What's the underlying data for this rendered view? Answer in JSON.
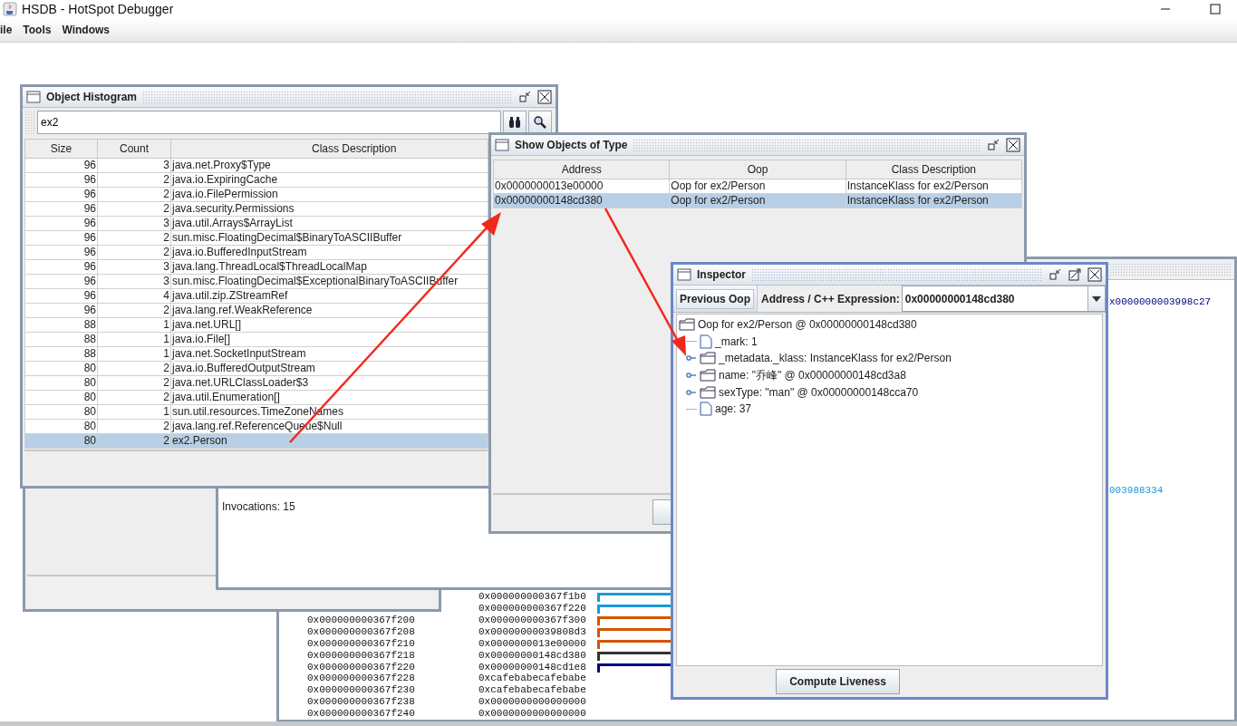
{
  "window": {
    "title": "HSDB - HotSpot Debugger"
  },
  "menu": [
    {
      "label": "ile"
    },
    {
      "label": "Tools"
    },
    {
      "label": "Windows"
    }
  ],
  "memory_viewer": {
    "top_text": "x0000000003998c27",
    "side_text": "003988334",
    "rows": [
      {
        "value": "0x000000000367f1b0",
        "color": "#1a9ad6"
      },
      {
        "value": "0x000000000367f220",
        "color": "#1a9ad6"
      },
      {
        "address": "0x000000000367f200",
        "value": "0x000000000367f300",
        "color": "#d35400"
      },
      {
        "address": "0x000000000367f208",
        "value": "0x00000000039808d3",
        "color": "#d35400"
      },
      {
        "address": "0x000000000367f210",
        "value": "0x0000000013e00000",
        "color": "#d35400"
      },
      {
        "address": "0x000000000367f218",
        "value": "0x00000000148cd380",
        "color": "#333333"
      },
      {
        "address": "0x000000000367f220",
        "value": "0x00000000148cd1e8",
        "color": "#00008b"
      },
      {
        "address": "0x000000000367f228",
        "value": "0xcafebabecafebabe"
      },
      {
        "address": "0x000000000367f230",
        "value": "0xcafebabecafebabe"
      },
      {
        "address": "0x000000000367f238",
        "value": "0x0000000000000000"
      },
      {
        "address": "0x000000000367f240",
        "value": "0x0000000000000000"
      }
    ]
  },
  "output_window": {
    "text": "Invocations: 15"
  },
  "object_histogram": {
    "title": "Object Histogram",
    "filter": "ex2",
    "columns": [
      "Size",
      "Count",
      "Class Description"
    ],
    "rows": [
      {
        "size": "96",
        "count": "3",
        "class": "java.net.Proxy$Type",
        "selected": false
      },
      {
        "size": "96",
        "count": "2",
        "class": "java.io.ExpiringCache",
        "selected": false
      },
      {
        "size": "96",
        "count": "2",
        "class": "java.io.FilePermission",
        "selected": false
      },
      {
        "size": "96",
        "count": "2",
        "class": "java.security.Permissions",
        "selected": false
      },
      {
        "size": "96",
        "count": "3",
        "class": "java.util.Arrays$ArrayList",
        "selected": false
      },
      {
        "size": "96",
        "count": "2",
        "class": "sun.misc.FloatingDecimal$BinaryToASCIIBuffer",
        "selected": false
      },
      {
        "size": "96",
        "count": "2",
        "class": "java.io.BufferedInputStream",
        "selected": false
      },
      {
        "size": "96",
        "count": "3",
        "class": "java.lang.ThreadLocal$ThreadLocalMap",
        "selected": false
      },
      {
        "size": "96",
        "count": "3",
        "class": "sun.misc.FloatingDecimal$ExceptionalBinaryToASCIIBuffer",
        "selected": false
      },
      {
        "size": "96",
        "count": "4",
        "class": "java.util.zip.ZStreamRef",
        "selected": false
      },
      {
        "size": "96",
        "count": "2",
        "class": "java.lang.ref.WeakReference",
        "selected": false
      },
      {
        "size": "88",
        "count": "1",
        "class": "java.net.URL[]",
        "selected": false
      },
      {
        "size": "88",
        "count": "1",
        "class": "java.io.File[]",
        "selected": false
      },
      {
        "size": "88",
        "count": "1",
        "class": "java.net.SocketInputStream",
        "selected": false
      },
      {
        "size": "80",
        "count": "2",
        "class": "java.io.BufferedOutputStream",
        "selected": false
      },
      {
        "size": "80",
        "count": "2",
        "class": "java.net.URLClassLoader$3",
        "selected": false
      },
      {
        "size": "80",
        "count": "2",
        "class": "java.util.Enumeration[]",
        "selected": false
      },
      {
        "size": "80",
        "count": "1",
        "class": "sun.util.resources.TimeZoneNames",
        "selected": false
      },
      {
        "size": "80",
        "count": "2",
        "class": "java.lang.ref.ReferenceQueue$Null",
        "selected": false
      },
      {
        "size": "80",
        "count": "2",
        "class": "ex2.Person",
        "selected": true
      }
    ]
  },
  "show_objects": {
    "title": "Show Objects of Type",
    "columns": [
      "Address",
      "Oop",
      "Class Description"
    ],
    "rows": [
      {
        "address": "0x0000000013e00000",
        "oop": "Oop for ex2/Person",
        "class": "InstanceKlass for ex2/Person",
        "selected": false
      },
      {
        "address": "0x00000000148cd380",
        "oop": "Oop for ex2/Person",
        "class": "InstanceKlass for ex2/Person",
        "selected": true
      }
    ]
  },
  "inspector": {
    "title": "Inspector",
    "previous_button": "Previous Oop",
    "address_label": "Address / C++ Expression:",
    "address": "0x00000000148cd380",
    "tree": {
      "label": "Oop for ex2/Person @ 0x00000000148cd380",
      "children": [
        {
          "kind": "field",
          "label": "_mark: 1"
        },
        {
          "kind": "object",
          "label": "_metadata._klass: InstanceKlass for ex2/Person",
          "expanded": false
        },
        {
          "kind": "object",
          "label": "name: \"乔峰\" @ 0x00000000148cd3a8",
          "expanded": false
        },
        {
          "kind": "object",
          "label": "sexType: \"man\" @ 0x00000000148cca70",
          "expanded": false
        },
        {
          "kind": "field",
          "label": "age: 37"
        }
      ]
    },
    "compute_button": "Compute Liveness"
  }
}
